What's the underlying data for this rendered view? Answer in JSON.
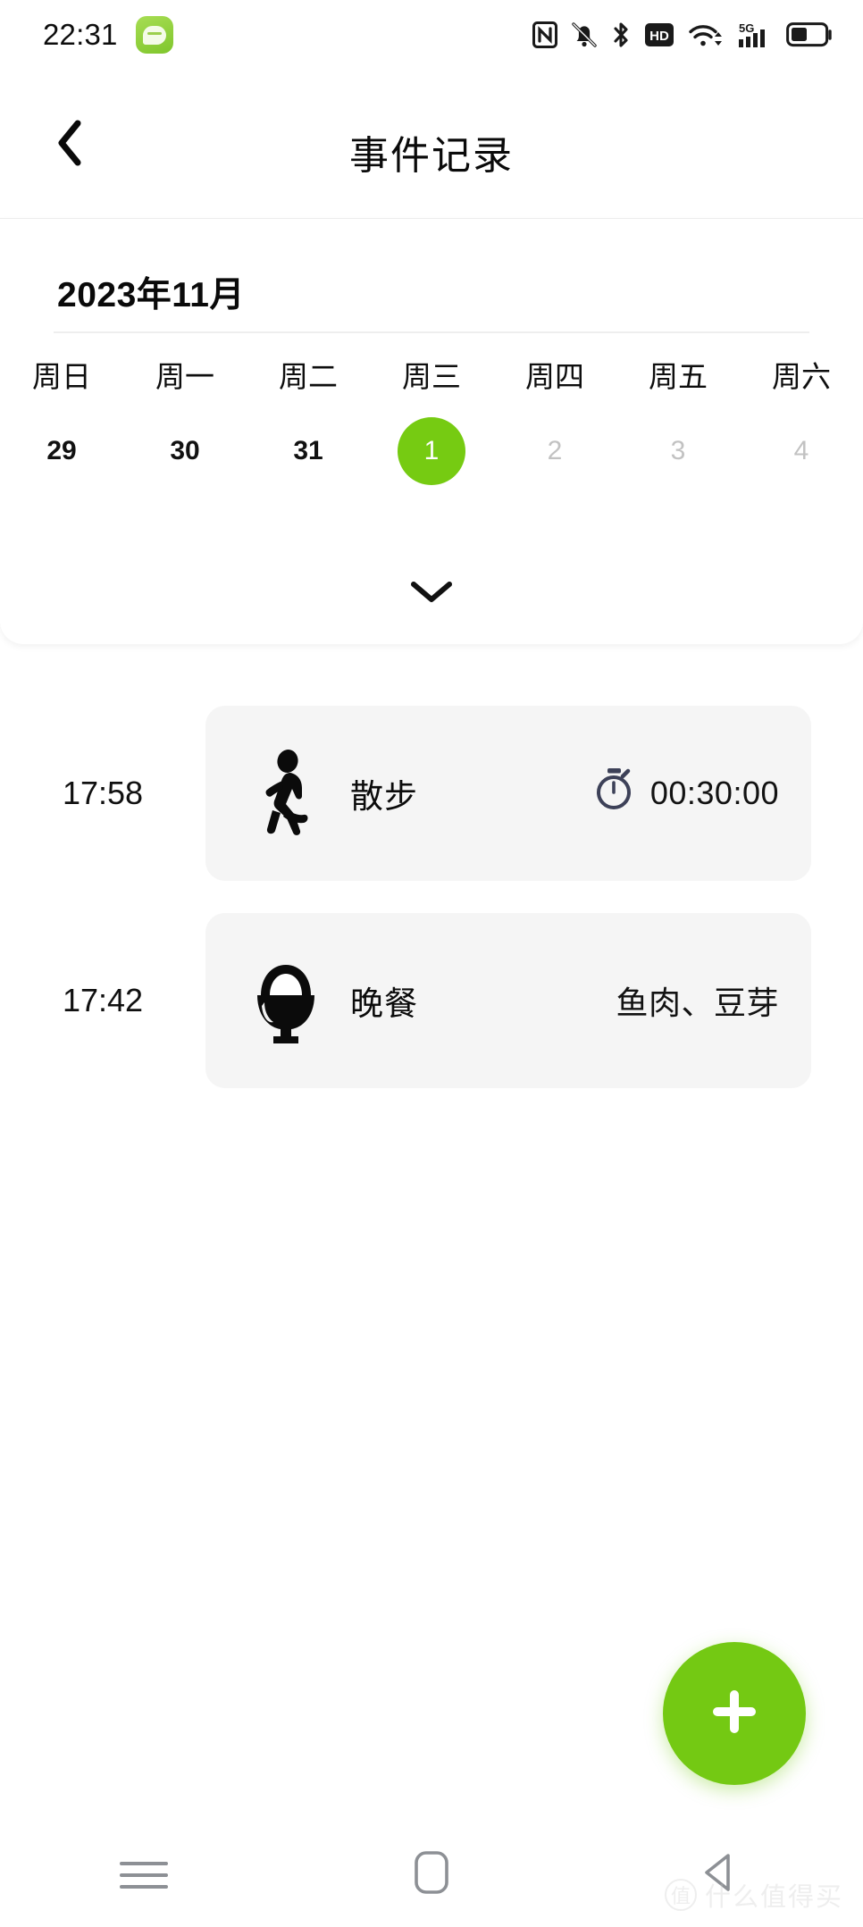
{
  "statusbar": {
    "time": "22:31",
    "app_icon": "message-bubble-icon",
    "icons": [
      "nfc-icon",
      "bell-muted-icon",
      "bluetooth-icon",
      "hd-icon",
      "wifi-icon",
      "signal-5g-icon",
      "battery-icon"
    ],
    "hd_label": "HD",
    "network_label": "5G",
    "battery_level_percent": 40
  },
  "header": {
    "back_icon": "chevron-left-icon",
    "title": "事件记录"
  },
  "calendar": {
    "month_label": "2023年11月",
    "weekdays": [
      "周日",
      "周一",
      "周二",
      "周三",
      "周四",
      "周五",
      "周六"
    ],
    "days": [
      {
        "label": "29",
        "state": "prev-month"
      },
      {
        "label": "30",
        "state": "prev-month"
      },
      {
        "label": "31",
        "state": "prev-month"
      },
      {
        "label": "1",
        "state": "selected"
      },
      {
        "label": "2",
        "state": "future"
      },
      {
        "label": "3",
        "state": "future"
      },
      {
        "label": "4",
        "state": "future"
      }
    ],
    "expand_icon": "chevron-down-icon",
    "accent_color": "#76cb12"
  },
  "events": [
    {
      "time": "17:58",
      "icon": "running-person-icon",
      "name": "散步",
      "meta_icon": "stopwatch-icon",
      "meta_text": "00:30:00"
    },
    {
      "time": "17:42",
      "icon": "food-bowl-icon",
      "name": "晚餐",
      "meta_icon": "",
      "meta_text": "鱼肉、豆芽"
    }
  ],
  "fab": {
    "icon": "plus-icon",
    "color": "#74c913"
  },
  "navbar": {
    "items": [
      "recents-icon",
      "home-icon",
      "back-triangle-icon"
    ]
  },
  "watermark": {
    "logo": "值",
    "text": "什么值得买"
  }
}
